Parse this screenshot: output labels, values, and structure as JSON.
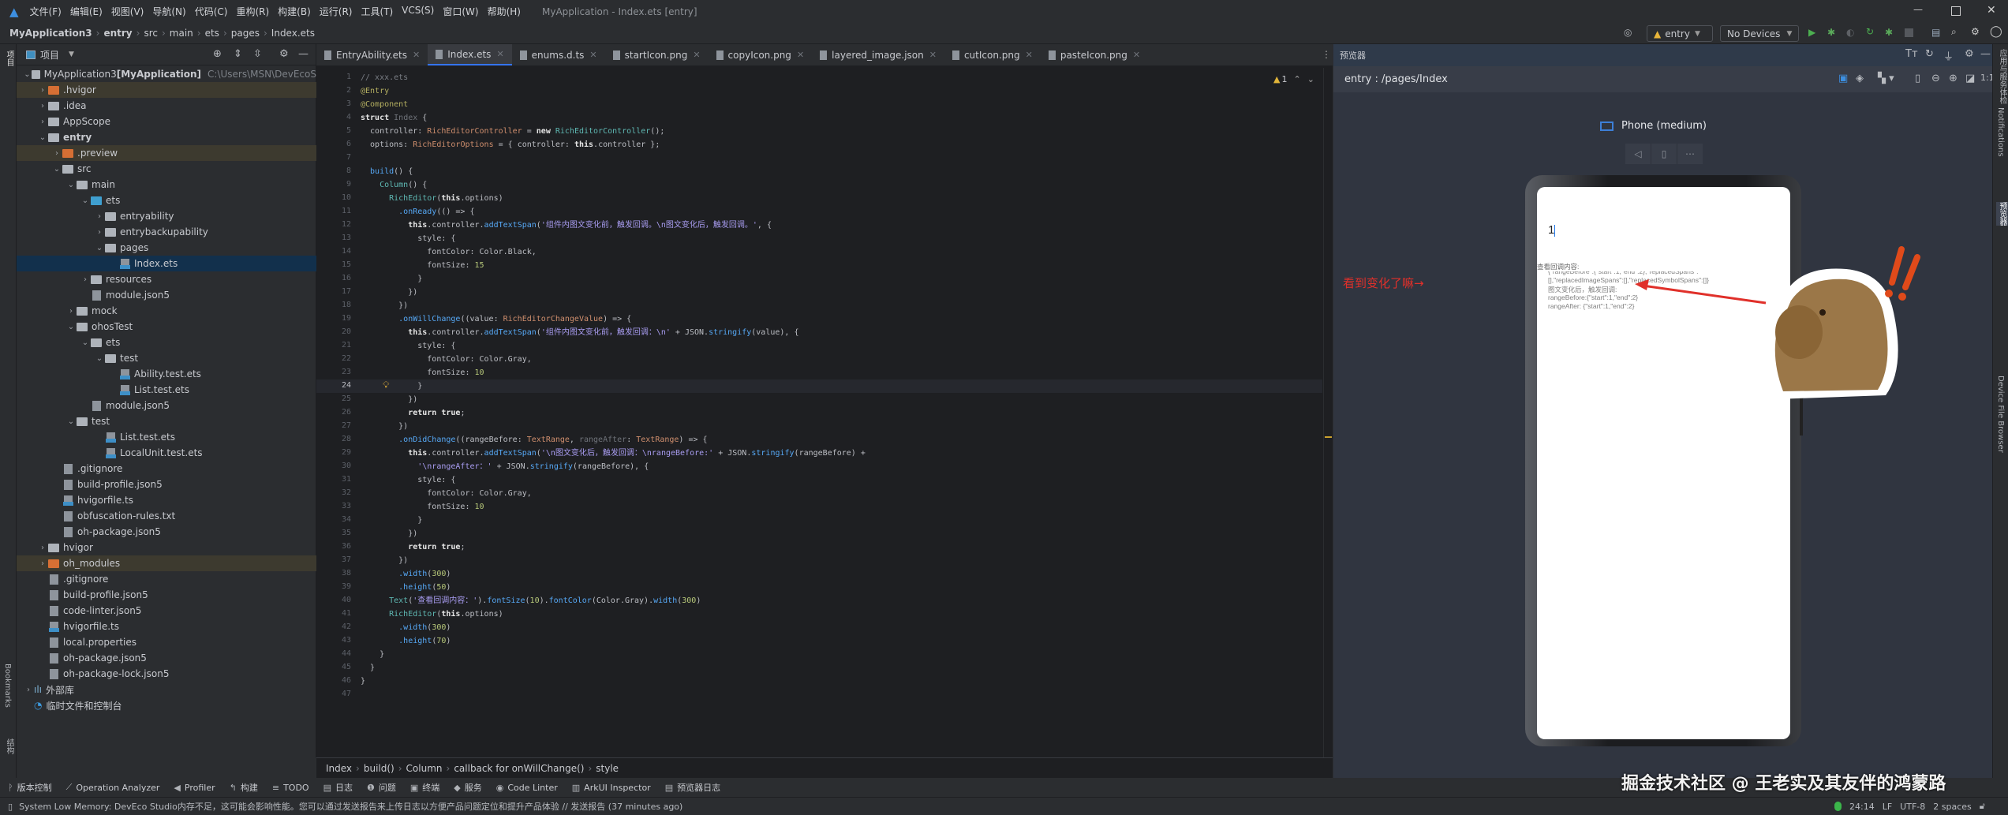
{
  "titlebar": {
    "menus": [
      "文件(F)",
      "编辑(E)",
      "视图(V)",
      "导航(N)",
      "代码(C)",
      "重构(R)",
      "构建(B)",
      "运行(R)",
      "工具(T)",
      "VCS(S)",
      "窗口(W)",
      "帮助(H)"
    ],
    "window_title": "MyApplication - Index.ets [entry]"
  },
  "navbar": {
    "breadcrumb": [
      "MyApplication3",
      "entry",
      "src",
      "main",
      "ets",
      "pages",
      "Index.ets"
    ],
    "run_config": "entry",
    "device": "No Devices"
  },
  "leftstrip": {
    "project": "项目",
    "bookmarks": "Bookmarks",
    "structure": "结构"
  },
  "project": {
    "title": "项目",
    "tree": [
      {
        "d": 0,
        "ex": "open",
        "kind": "module",
        "label": "MyApplication3",
        "extra": " [MyApplication]",
        "path": "C:\\Users\\MSN\\DevEcoS"
      },
      {
        "d": 1,
        "ex": "closed",
        "kind": "orange",
        "label": ".hvigor",
        "hl": true
      },
      {
        "d": 1,
        "ex": "closed",
        "kind": "folder",
        "label": ".idea"
      },
      {
        "d": 1,
        "ex": "closed",
        "kind": "folder",
        "label": "AppScope"
      },
      {
        "d": 1,
        "ex": "open",
        "kind": "module",
        "label": "entry",
        "bold": true
      },
      {
        "d": 2,
        "ex": "closed",
        "kind": "orange",
        "label": ".preview",
        "hl": true
      },
      {
        "d": 2,
        "ex": "open",
        "kind": "folder",
        "label": "src"
      },
      {
        "d": 3,
        "ex": "open",
        "kind": "folder",
        "label": "main"
      },
      {
        "d": 4,
        "ex": "open",
        "kind": "blue",
        "label": "ets"
      },
      {
        "d": 5,
        "ex": "closed",
        "kind": "folder",
        "label": "entryability"
      },
      {
        "d": 5,
        "ex": "closed",
        "kind": "folder",
        "label": "entrybackupability"
      },
      {
        "d": 5,
        "ex": "open",
        "kind": "folder",
        "label": "pages"
      },
      {
        "d": 6,
        "ex": "none",
        "kind": "ets",
        "label": "Index.ets",
        "sel": true
      },
      {
        "d": 4,
        "ex": "closed",
        "kind": "folder",
        "label": "resources"
      },
      {
        "d": 4,
        "ex": "none",
        "kind": "json",
        "label": "module.json5"
      },
      {
        "d": 3,
        "ex": "closed",
        "kind": "folder",
        "label": "mock"
      },
      {
        "d": 3,
        "ex": "open",
        "kind": "folder",
        "label": "ohosTest"
      },
      {
        "d": 4,
        "ex": "open",
        "kind": "folder",
        "label": "ets"
      },
      {
        "d": 5,
        "ex": "open",
        "kind": "folder",
        "label": "test"
      },
      {
        "d": 6,
        "ex": "none",
        "kind": "ets",
        "label": "Ability.test.ets"
      },
      {
        "d": 6,
        "ex": "none",
        "kind": "ets",
        "label": "List.test.ets"
      },
      {
        "d": 4,
        "ex": "none",
        "kind": "json",
        "label": "module.json5"
      },
      {
        "d": 3,
        "ex": "open",
        "kind": "folder",
        "label": "test"
      },
      {
        "d": 5,
        "ex": "none",
        "kind": "ets",
        "label": "List.test.ets"
      },
      {
        "d": 5,
        "ex": "none",
        "kind": "ets",
        "label": "LocalUnit.test.ets"
      },
      {
        "d": 2,
        "ex": "none",
        "kind": "file",
        "label": ".gitignore"
      },
      {
        "d": 2,
        "ex": "none",
        "kind": "json",
        "label": "build-profile.json5"
      },
      {
        "d": 2,
        "ex": "none",
        "kind": "ts",
        "label": "hvigorfile.ts"
      },
      {
        "d": 2,
        "ex": "none",
        "kind": "file",
        "label": "obfuscation-rules.txt"
      },
      {
        "d": 2,
        "ex": "none",
        "kind": "json",
        "label": "oh-package.json5"
      },
      {
        "d": 1,
        "ex": "closed",
        "kind": "folder",
        "label": "hvigor"
      },
      {
        "d": 1,
        "ex": "closed",
        "kind": "orange",
        "label": "oh_modules",
        "hl": true
      },
      {
        "d": 1,
        "ex": "none",
        "kind": "file",
        "label": ".gitignore"
      },
      {
        "d": 1,
        "ex": "none",
        "kind": "json",
        "label": "build-profile.json5"
      },
      {
        "d": 1,
        "ex": "none",
        "kind": "json",
        "label": "code-linter.json5"
      },
      {
        "d": 1,
        "ex": "none",
        "kind": "ts",
        "label": "hvigorfile.ts"
      },
      {
        "d": 1,
        "ex": "none",
        "kind": "file",
        "label": "local.properties"
      },
      {
        "d": 1,
        "ex": "none",
        "kind": "json",
        "label": "oh-package.json5"
      },
      {
        "d": 1,
        "ex": "none",
        "kind": "json",
        "label": "oh-package-lock.json5"
      },
      {
        "d": 0,
        "ex": "closed",
        "kind": "lib",
        "label": "外部库"
      },
      {
        "d": 0,
        "ex": "none",
        "kind": "scratch",
        "label": "临时文件和控制台"
      }
    ]
  },
  "editor": {
    "tabs": [
      {
        "label": "EntryAbility.ets"
      },
      {
        "label": "Index.ets",
        "active": true
      },
      {
        "label": "enums.d.ts"
      },
      {
        "label": "startIcon.png"
      },
      {
        "label": "copyIcon.png"
      },
      {
        "label": "layered_image.json"
      },
      {
        "label": "cutIcon.png"
      },
      {
        "label": "pasteIcon.png"
      }
    ],
    "warnings": "1",
    "current_line": 24,
    "lines": [
      [
        [
          "c",
          "// xxx.ets"
        ]
      ],
      [
        [
          "a",
          "@Entry"
        ]
      ],
      [
        [
          "a",
          "@Component"
        ]
      ],
      [
        [
          "w",
          "struct "
        ],
        [
          "g",
          "Index "
        ],
        [
          "p",
          "{"
        ]
      ],
      [
        [
          "p",
          "  controller: "
        ],
        [
          "t",
          "RichEditorController"
        ],
        [
          "p",
          " = "
        ],
        [
          "w",
          "new "
        ],
        [
          "f",
          "RichEditorController"
        ],
        [
          "p",
          "();"
        ]
      ],
      [
        [
          "p",
          "  options: "
        ],
        [
          "t",
          "RichEditorOptions"
        ],
        [
          "p",
          " = { controller: "
        ],
        [
          "w",
          "this"
        ],
        [
          "p",
          ".controller };"
        ]
      ],
      [],
      [
        [
          "m",
          "  build"
        ],
        [
          "p",
          "() {"
        ]
      ],
      [
        [
          "f",
          "    Column"
        ],
        [
          "p",
          "() {"
        ]
      ],
      [
        [
          "f",
          "      RichEditor"
        ],
        [
          "p",
          "("
        ],
        [
          "w",
          "this"
        ],
        [
          "p",
          ".options)"
        ]
      ],
      [
        [
          "m",
          "        .onReady"
        ],
        [
          "p",
          "(() => {"
        ]
      ],
      [
        [
          "w",
          "          this"
        ],
        [
          "p",
          ".controller."
        ],
        [
          "m",
          "addTextSpan"
        ],
        [
          "p",
          "("
        ],
        [
          "s",
          "'组件内图文变化前，触发回调。\\n图文变化后，触发回调。'"
        ],
        [
          "p",
          ", {"
        ]
      ],
      [
        [
          "p",
          "            style: {"
        ]
      ],
      [
        [
          "p",
          "              fontColor: Color.Black,"
        ]
      ],
      [
        [
          "p",
          "              fontSize: "
        ],
        [
          "n",
          "15"
        ]
      ],
      [
        [
          "p",
          "            }"
        ]
      ],
      [
        [
          "p",
          "          })"
        ]
      ],
      [
        [
          "p",
          "        })"
        ]
      ],
      [
        [
          "m",
          "        .onWillChange"
        ],
        [
          "p",
          "((value: "
        ],
        [
          "t",
          "RichEditorChangeValue"
        ],
        [
          "p",
          ") => {"
        ]
      ],
      [
        [
          "w",
          "          this"
        ],
        [
          "p",
          ".controller."
        ],
        [
          "m",
          "addTextSpan"
        ],
        [
          "p",
          "("
        ],
        [
          "s",
          "'组件内图文变化前，触发回调：\\n'"
        ],
        [
          "p",
          " + JSON."
        ],
        [
          "m",
          "stringify"
        ],
        [
          "p",
          "(value), {"
        ]
      ],
      [
        [
          "p",
          "            style: {"
        ]
      ],
      [
        [
          "p",
          "              fontColor: Color.Gray,"
        ]
      ],
      [
        [
          "p",
          "              fontSize: "
        ],
        [
          "n",
          "10"
        ]
      ],
      [
        [
          "p",
          "            }"
        ]
      ],
      [
        [
          "p",
          "          })"
        ]
      ],
      [
        [
          "w",
          "          return true"
        ],
        [
          "p",
          ";"
        ]
      ],
      [
        [
          "p",
          "        })"
        ]
      ],
      [
        [
          "m",
          "        .onDidChange"
        ],
        [
          "p",
          "((rangeBefore: "
        ],
        [
          "t",
          "TextRange"
        ],
        [
          "p",
          ", "
        ],
        [
          "g",
          "rangeAfter"
        ],
        [
          "p",
          ": "
        ],
        [
          "t",
          "TextRange"
        ],
        [
          "p",
          ") => {"
        ]
      ],
      [
        [
          "w",
          "          this"
        ],
        [
          "p",
          ".controller."
        ],
        [
          "m",
          "addTextSpan"
        ],
        [
          "p",
          "("
        ],
        [
          "s",
          "'\\n图文变化后，触发回调：\\nrangeBefore:'"
        ],
        [
          "p",
          " + JSON."
        ],
        [
          "m",
          "stringify"
        ],
        [
          "p",
          "(rangeBefore) +"
        ]
      ],
      [
        [
          "s",
          "            '\\nrangeAfter：'"
        ],
        [
          "p",
          " + JSON."
        ],
        [
          "m",
          "stringify"
        ],
        [
          "p",
          "(rangeBefore), {"
        ]
      ],
      [
        [
          "p",
          "            style: {"
        ]
      ],
      [
        [
          "p",
          "              fontColor: Color.Gray,"
        ]
      ],
      [
        [
          "p",
          "              fontSize: "
        ],
        [
          "n",
          "10"
        ]
      ],
      [
        [
          "p",
          "            }"
        ]
      ],
      [
        [
          "p",
          "          })"
        ]
      ],
      [
        [
          "w",
          "          return true"
        ],
        [
          "p",
          ";"
        ]
      ],
      [
        [
          "p",
          "        })"
        ]
      ],
      [
        [
          "m",
          "        .width"
        ],
        [
          "p",
          "("
        ],
        [
          "n",
          "300"
        ],
        [
          "p",
          ")"
        ]
      ],
      [
        [
          "m",
          "        .height"
        ],
        [
          "p",
          "("
        ],
        [
          "n",
          "50"
        ],
        [
          "p",
          ")"
        ]
      ],
      [
        [
          "f",
          "      Text"
        ],
        [
          "p",
          "("
        ],
        [
          "s",
          "'查看回调内容：'"
        ],
        [
          "p",
          ")."
        ],
        [
          "m",
          "fontSize"
        ],
        [
          "p",
          "("
        ],
        [
          "n",
          "10"
        ],
        [
          "p",
          ")."
        ],
        [
          "m",
          "fontColor"
        ],
        [
          "p",
          "(Color.Gray)."
        ],
        [
          "m",
          "width"
        ],
        [
          "p",
          "("
        ],
        [
          "n",
          "300"
        ],
        [
          "p",
          ")"
        ]
      ],
      [
        [
          "f",
          "      RichEditor"
        ],
        [
          "p",
          "("
        ],
        [
          "w",
          "this"
        ],
        [
          "p",
          ".options)"
        ]
      ],
      [
        [
          "m",
          "        .width"
        ],
        [
          "p",
          "("
        ],
        [
          "n",
          "300"
        ],
        [
          "p",
          ")"
        ]
      ],
      [
        [
          "m",
          "        .height"
        ],
        [
          "p",
          "("
        ],
        [
          "n",
          "70"
        ],
        [
          "p",
          ")"
        ]
      ],
      [
        [
          "p",
          "    }"
        ]
      ],
      [
        [
          "p",
          "  }"
        ]
      ],
      [
        [
          "p",
          "}"
        ]
      ],
      []
    ],
    "breadcrumb": [
      "Index",
      "build()",
      "Column",
      "callback for onWillChange()",
      "style"
    ]
  },
  "preview": {
    "panel_title": "预览器",
    "route": "entry : /pages/Index",
    "device_name": "Phone (medium)",
    "editor_text": "1",
    "label": "查看回调内容:",
    "callback_lines": [
      "{\"rangeBefore\":{\"start\":1,\"end\":2},\"replacedSpans\":",
      "[],\"replacedImageSpans\":[],\"replacedSymbolSpans\":[]}",
      "图文变化后，触发回调:",
      "rangeBefore:{\"start\":1,\"end\":2}",
      "rangeAfter: {\"start\":1,\"end\":2}"
    ],
    "annotation": "看到变化了嘛→",
    "annotation_color": "#e0302a"
  },
  "rightstrip": [
    "应用与服务体检",
    "Notifications",
    "预览器",
    "Device File Browser"
  ],
  "toolwindows": [
    "版本控制",
    "Operation Analyzer",
    "Profiler",
    "构建",
    "TODO",
    "日志",
    "问题",
    "终端",
    "服务",
    "Code Linter",
    "ArkUI Inspector",
    "预览器日志"
  ],
  "status": {
    "message": "System Low Memory: DevEco Studio内存不足，这可能会影响性能。您可以通过发送报告来上传日志以方便产品问题定位和提升产品体验 // 发送报告 (37 minutes ago)",
    "position": "24:14",
    "line_sep": "LF",
    "encoding": "UTF-8",
    "indent": "2 spaces"
  },
  "watermark": "掘金技术社区 @ 王老实及其友伴的鸿蒙路"
}
